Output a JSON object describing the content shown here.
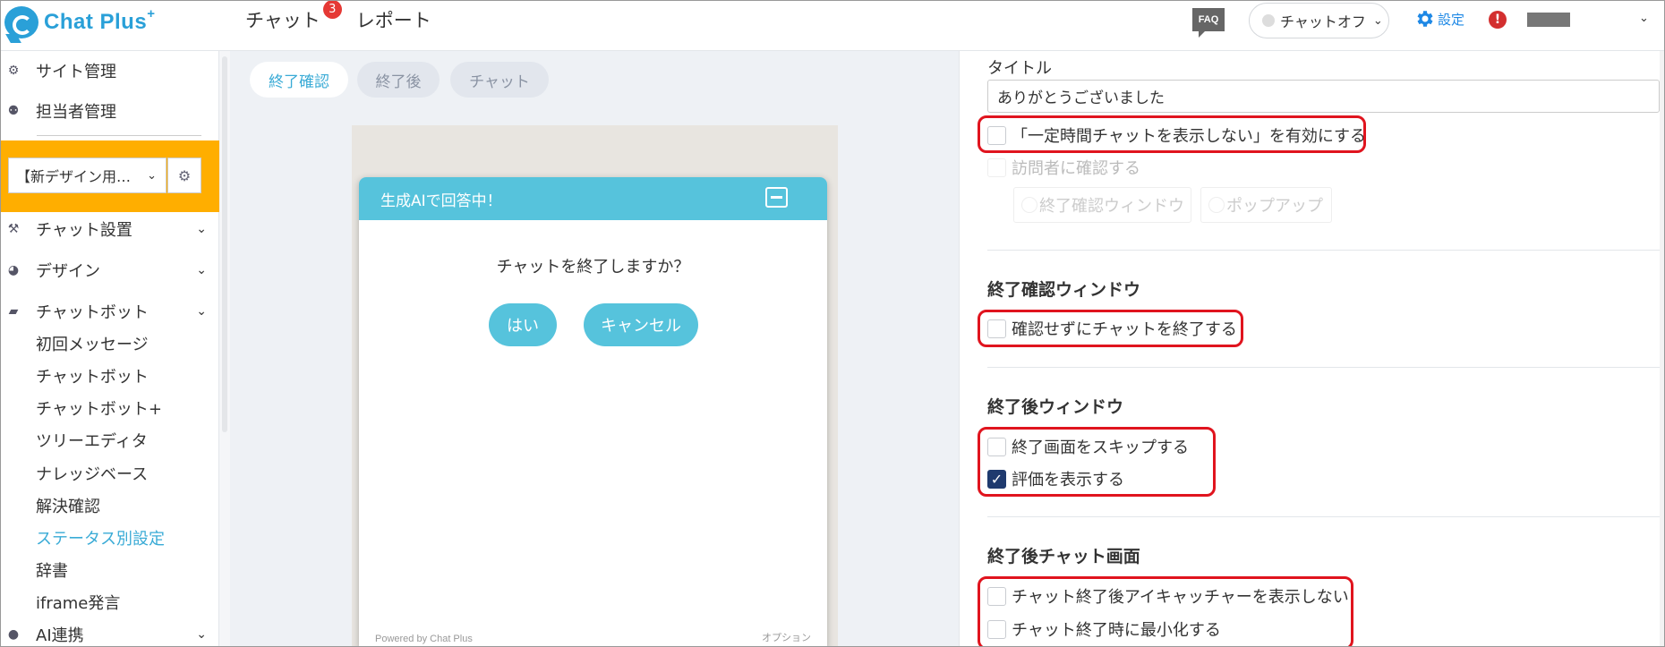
{
  "app": {
    "logo_text": "Chat Plus",
    "logo_sup": "+"
  },
  "topnav": {
    "chat_label": "チャット",
    "chat_badge": "3",
    "report_label": "レポート"
  },
  "header": {
    "faq_label": "FAQ",
    "status_label": "チャットオフ",
    "settings_label": "設定",
    "alert_label": "!"
  },
  "sidebar": {
    "site_manage": "サイト管理",
    "staff_manage": "担当者管理",
    "site_select_value": "【新デザイン用…",
    "chat_setup": "チャット設置",
    "design": "デザイン",
    "chatbot": "チャットボット",
    "sub_items": [
      "初回メッセージ",
      "チャットボット",
      "チャットボット+",
      "ツリーエディタ",
      "ナレッジベース",
      "解決確認",
      "ステータス別設定",
      "辞書",
      "iframe発言"
    ],
    "ai_link": "AI連携"
  },
  "tabs": [
    "終了確認",
    "終了後",
    "チャット"
  ],
  "preview": {
    "header_title": "生成AIで回答中！",
    "question": "チャットを終了しますか？",
    "yes_button": "はい",
    "cancel_button": "キャンセル",
    "powered_by": "Powered by Chat Plus",
    "option": "オプション"
  },
  "right": {
    "title_label": "タイトル",
    "title_value": "ありがとうございました",
    "hide_chat_for_time": "「一定時間チャットを表示しない」を有効にする",
    "confirm_visitor": "訪問者に確認する",
    "radio_confirm_window": "終了確認ウィンドウ",
    "radio_popup": "ポップアップ",
    "section_confirm_window": "終了確認ウィンドウ",
    "end_without_confirm": "確認せずにチャットを終了する",
    "section_after_window": "終了後ウィンドウ",
    "skip_end_screen": "終了画面をスキップする",
    "show_rating": "評価を表示する",
    "section_after_chat": "終了後チャット画面",
    "hide_eyecatcher": "チャット終了後アイキャッチャーを表示しない",
    "minimize_on_end": "チャット終了時に最小化する"
  },
  "colors": {
    "accent": "#3aabd6",
    "highlight": "#e0141e",
    "sidebar_select_bg": "#ffae00",
    "checkbox_checked": "#1f3a6e"
  }
}
